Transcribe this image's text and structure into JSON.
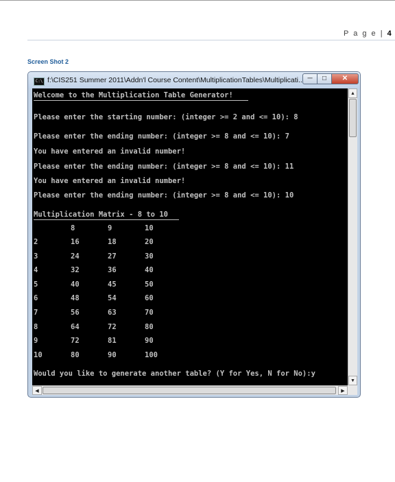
{
  "page": {
    "label": "P a g e",
    "separator": "|",
    "number": "4"
  },
  "caption": "Screen Shot 2",
  "window": {
    "title": "f:\\CIS251 Summer 2011\\Addn'l Course Content\\MultiplicationTables\\Multiplicati...",
    "app_icon": "C:\\",
    "minimize_icon": "minimize-icon",
    "maximize_icon": "maximize-icon",
    "close_icon": "close-icon"
  },
  "console": {
    "welcome": "Welcome to the Multiplication Table Generator!",
    "prompt_start": "Please enter the starting number: (integer >= 2 and <= 10): 8",
    "prompt_end_1": "Please enter the ending number: (integer >= 8 and <= 10): 7",
    "invalid_1": "You have entered an invalid number!",
    "prompt_end_2": "Please enter the ending number: (integer >= 8 and <= 10): 11",
    "invalid_2": "You have entered an invalid number!",
    "prompt_end_3": "Please enter the ending number: (integer >= 8 and <= 10): 10",
    "matrix_title": "Multiplication Matrix - 8 to 10",
    "header_row": [
      "8",
      "9",
      "10"
    ],
    "rows": [
      [
        "2",
        "16",
        "18",
        "20"
      ],
      [
        "3",
        "24",
        "27",
        "30"
      ],
      [
        "4",
        "32",
        "36",
        "40"
      ],
      [
        "5",
        "40",
        "45",
        "50"
      ],
      [
        "6",
        "48",
        "54",
        "60"
      ],
      [
        "7",
        "56",
        "63",
        "70"
      ],
      [
        "8",
        "64",
        "72",
        "80"
      ],
      [
        "9",
        "72",
        "81",
        "90"
      ],
      [
        "10",
        "80",
        "90",
        "100"
      ]
    ],
    "again_prompt": "Would you like to generate another table? (Y for Yes, N for No):y"
  }
}
